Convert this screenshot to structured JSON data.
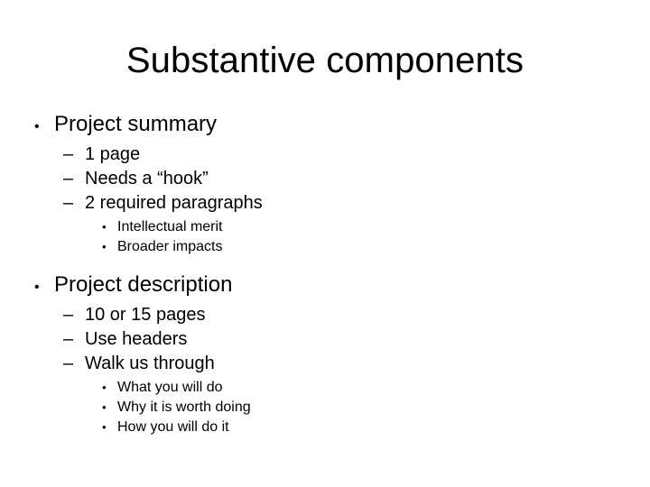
{
  "slide": {
    "title": "Substantive components",
    "markers": {
      "level1": "•",
      "level2": "–",
      "level3": "•"
    },
    "sections": [
      {
        "heading": "Project summary",
        "sub": [
          {
            "text": "1 page"
          },
          {
            "text": "Needs a “hook”"
          },
          {
            "text": "2 required paragraphs",
            "sub": [
              {
                "text": "Intellectual merit"
              },
              {
                "text": "Broader impacts"
              }
            ]
          }
        ]
      },
      {
        "heading": "Project description",
        "sub": [
          {
            "text": "10 or 15 pages"
          },
          {
            "text": "Use headers"
          },
          {
            "text": "Walk us through",
            "sub": [
              {
                "text": "What you will do"
              },
              {
                "text": "Why it is worth doing"
              },
              {
                "text": "How you will do it"
              }
            ]
          }
        ]
      }
    ]
  }
}
